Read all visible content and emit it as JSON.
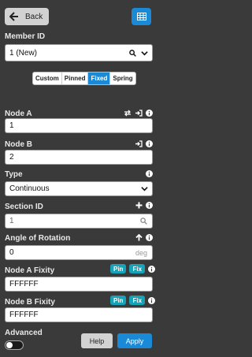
{
  "header": {
    "back_label": "Back"
  },
  "member_id": {
    "label": "Member ID",
    "value": "1 (New)"
  },
  "segments": {
    "items": [
      "Custom",
      "Pinned",
      "Fixed",
      "Spring"
    ],
    "active": "Fixed"
  },
  "node_a": {
    "label": "Node A",
    "value": "1"
  },
  "node_b": {
    "label": "Node B",
    "value": "2"
  },
  "type": {
    "label": "Type",
    "value": "Continuous"
  },
  "section_id": {
    "label": "Section ID",
    "value": "1"
  },
  "angle": {
    "label": "Angle of Rotation",
    "value": "0",
    "unit": "deg"
  },
  "node_a_fixity": {
    "label": "Node A Fixity",
    "value": "FFFFFF",
    "pin": "Pin",
    "fix": "Fix"
  },
  "node_b_fixity": {
    "label": "Node B Fixity",
    "value": "FFFFFF",
    "pin": "Pin",
    "fix": "Fix"
  },
  "advanced": {
    "label": "Advanced"
  },
  "footer": {
    "help_label": "Help",
    "apply_label": "Apply"
  },
  "colors": {
    "accent": "#1a8ad6",
    "teal": "#17a2b8",
    "bg": "#3a3a3a"
  }
}
